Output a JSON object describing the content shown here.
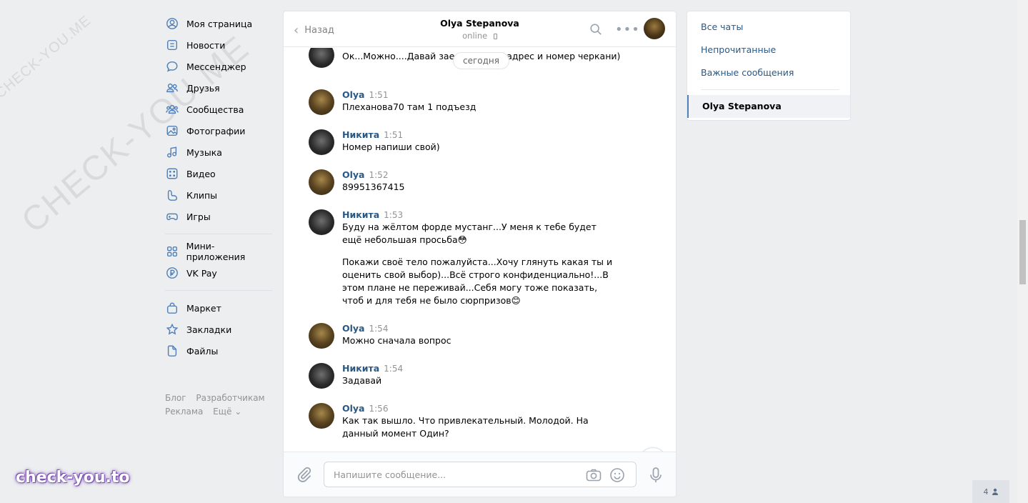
{
  "watermarks": {
    "corner": "CHECK-YOU.ME",
    "big": "CHECK-YOU.ME",
    "brand": "check-you.to"
  },
  "nav": {
    "items": [
      {
        "label": "Моя страница",
        "icon": "user-circle-icon"
      },
      {
        "label": "Новости",
        "icon": "news-icon"
      },
      {
        "label": "Мессенджер",
        "icon": "chat-bubble-icon"
      },
      {
        "label": "Друзья",
        "icon": "friends-icon"
      },
      {
        "label": "Сообщества",
        "icon": "communities-icon"
      },
      {
        "label": "Фотографии",
        "icon": "photo-icon"
      },
      {
        "label": "Музыка",
        "icon": "music-note-icon"
      },
      {
        "label": "Видео",
        "icon": "video-icon"
      },
      {
        "label": "Клипы",
        "icon": "clips-icon"
      },
      {
        "label": "Игры",
        "icon": "gamepad-icon"
      }
    ],
    "items2": [
      {
        "label": "Мини-приложения",
        "icon": "apps-grid-icon"
      },
      {
        "label": "VK Pay",
        "icon": "ruble-coin-icon"
      }
    ],
    "items3": [
      {
        "label": "Маркет",
        "icon": "shopping-bag-icon"
      },
      {
        "label": "Закладки",
        "icon": "star-icon"
      },
      {
        "label": "Файлы",
        "icon": "file-icon"
      }
    ],
    "footer": {
      "blog": "Блог",
      "developers": "Разработчикам",
      "ads": "Реклама",
      "more": "Ещё ⌄"
    }
  },
  "chat": {
    "back_label": "Назад",
    "peer_name": "Olya Stepanova",
    "peer_status": "online",
    "date_divider": "сегодня",
    "messages": [
      {
        "author": "",
        "time": "",
        "avatar": "nikita",
        "texts": [
          "Ок...Можно....Давай заеду... Пиши адрес и номер черкани)"
        ]
      },
      {
        "author": "Olya",
        "time": "1:51",
        "avatar": "olya",
        "texts": [
          "Плеханова70 там 1 подъезд"
        ]
      },
      {
        "author": "Никита",
        "time": "1:51",
        "avatar": "nikita",
        "texts": [
          "Номер напиши свой)"
        ]
      },
      {
        "author": "Olya",
        "time": "1:52",
        "avatar": "olya",
        "texts": [
          "89951367415"
        ]
      },
      {
        "author": "Никита",
        "time": "1:53",
        "avatar": "nikita",
        "texts": [
          "Буду на жёлтом форде мустанг...У меня к тебе будет ещё небольшая просьба😳",
          "Покажи своё тело пожалуйста...Хочу глянуть какая ты и оценить свой выбор)...Всё строго конфиденциально!...В этом плане не переживай...Себя могу тоже показать, чтоб и для тебя не было сюрпризов😊"
        ]
      },
      {
        "author": "Olya",
        "time": "1:54",
        "avatar": "olya",
        "texts": [
          "Можно сначала вопрос"
        ]
      },
      {
        "author": "Никита",
        "time": "1:54",
        "avatar": "nikita",
        "texts": [
          "Задавай"
        ]
      },
      {
        "author": "Olya",
        "time": "1:56",
        "avatar": "olya",
        "texts": [
          "Как так вышло. Что привлекательный. Молодой. На данный момент Один?"
        ]
      }
    ],
    "composer_placeholder": "Напишите сообщение..."
  },
  "right_panel": {
    "all_chats": "Все чаты",
    "unread": "Непрочитанные",
    "important": "Важные сообщения",
    "active_chat": "Olya Stepanova"
  },
  "online_count": "4"
}
